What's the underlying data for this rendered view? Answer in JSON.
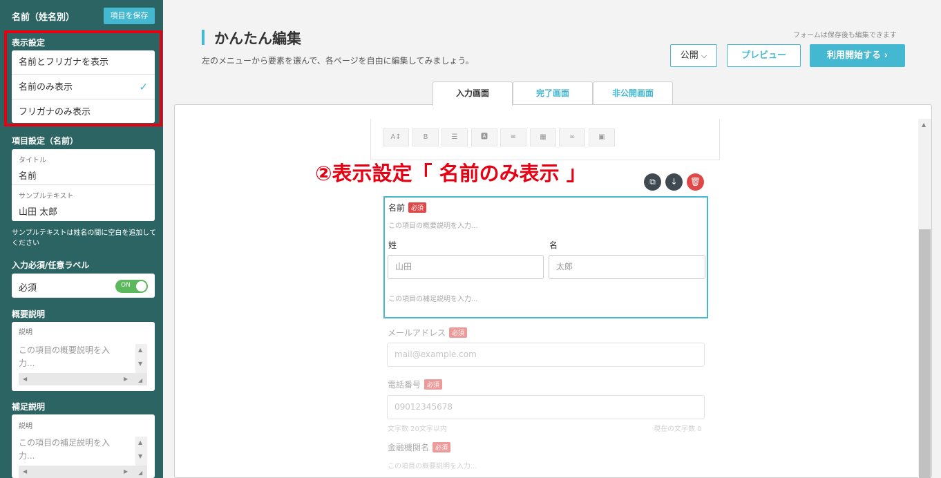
{
  "sidebar": {
    "title": "名前（姓名別）",
    "save_label": "項目を保存",
    "display_section": "表示設定",
    "display_options": [
      {
        "label": "名前とフリガナを表示",
        "selected": false
      },
      {
        "label": "名前のみ表示",
        "selected": true
      },
      {
        "label": "フリガナのみ表示",
        "selected": false
      }
    ],
    "check_mark": "✓",
    "item_section": "項目設定（名前）",
    "title_label": "タイトル",
    "title_value": "名前",
    "sample_label": "サンプルテキスト",
    "sample_value": "山田 太郎",
    "sample_note": "サンプルテキストは姓名の間に空白を追加してください",
    "required_section": "入力必須/任意ラベル",
    "required_label": "必須",
    "toggle_label": "ON",
    "summary_section": "概要説明",
    "summary_label": "説明",
    "summary_placeholder": "この項目の概要説明を入力...",
    "supp_section": "補足説明",
    "supp_label": "説明",
    "supp_placeholder": "この項目の補足説明を入力..."
  },
  "header": {
    "title": "かんたん編集",
    "subtitle": "左のメニューから要素を選んで、各ページを自由に編集してみましょう。",
    "save_note": "フォームは保存後も編集できます",
    "publish_label": "公開",
    "preview_label": "プレビュー",
    "start_label": "利用開始する"
  },
  "tabs": [
    "入力画面",
    "完了画面",
    "非公開画面"
  ],
  "toolbar_icons": [
    "font-size-icon",
    "bold-icon",
    "list-icon",
    "text-color-icon",
    "align-icon",
    "table-icon",
    "link-icon",
    "image-icon"
  ],
  "annotation": "②表示設定「 名前のみ表示 」",
  "form": {
    "name_label": "名前",
    "required_badge": "必須",
    "summary_hint": "この項目の概要説明を入力...",
    "last_label": "姓",
    "first_label": "名",
    "last_placeholder": "山田",
    "first_placeholder": "太郎",
    "supp_hint": "この項目の補足説明を入力...",
    "email_label": "メールアドレス",
    "email_placeholder": "mail@example.com",
    "phone_label": "電話番号",
    "phone_placeholder": "09012345678",
    "char_limit": "文字数 20文字以内",
    "char_count": "現在の文字数 0",
    "bank_label": "金融機関名",
    "bank_hint": "この項目の概要説明を入力..."
  }
}
